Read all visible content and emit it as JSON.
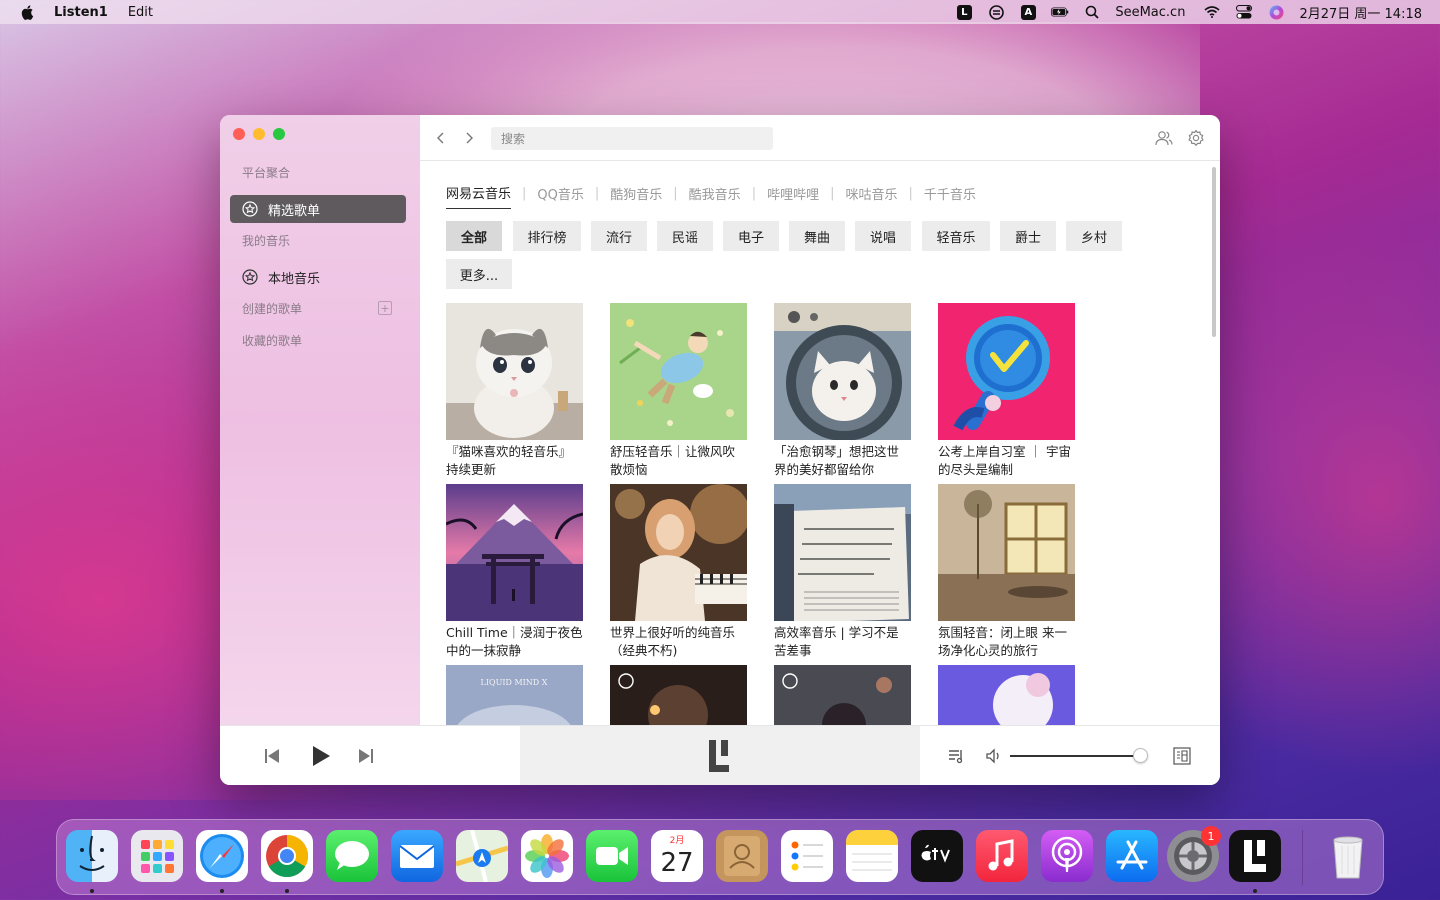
{
  "menubar": {
    "app_name": "Listen1",
    "menus": [
      "Edit"
    ],
    "status_text": "SeeMac.cn",
    "datetime": "2月27日 周一  14:18",
    "box_a_label": "A"
  },
  "sidebar": {
    "section_platform": "平台聚合",
    "item_featured": "精选歌单",
    "section_my_music": "我的音乐",
    "item_local": "本地音乐",
    "section_created": "创建的歌单",
    "section_favorited": "收藏的歌单"
  },
  "toolbar": {
    "search_placeholder": "搜索"
  },
  "platform_tabs": [
    "网易云音乐",
    "QQ音乐",
    "酷狗音乐",
    "酷我音乐",
    "哔哩哔哩",
    "咪咕音乐",
    "千千音乐"
  ],
  "genres": [
    "全部",
    "排行榜",
    "流行",
    "民谣",
    "电子",
    "舞曲",
    "说唱",
    "轻音乐",
    "爵士",
    "乡村",
    "更多..."
  ],
  "playlists": [
    {
      "title": "『猫咪喜欢的轻音乐』持续更新"
    },
    {
      "title": "舒压轻音乐｜让微风吹散烦恼"
    },
    {
      "title": "「治愈钢琴」想把这世界的美好都留给你"
    },
    {
      "title": "公考上岸自习室 ｜ 宇宙的尽头是编制"
    },
    {
      "title": "Chill Time｜浸润于夜色中的一抹寂静"
    },
    {
      "title": "世界上很好听的纯音乐（经典不朽)"
    },
    {
      "title": "高效率音乐 | 学习不是苦差事"
    },
    {
      "title": "氛围轻音：闭上眼 来一场净化心灵的旅行"
    }
  ],
  "cover_texts": {
    "liquid_mind": "LIQUID MIND X",
    "calendar_month": "2月",
    "calendar_day": "27"
  },
  "player": {
    "volume_percent": 95
  },
  "dock": {
    "settings_badge": "1",
    "apps": [
      "Finder",
      "Launchpad",
      "Safari",
      "Chrome",
      "Messages",
      "Mail",
      "Maps",
      "Photos",
      "FaceTime",
      "Calendar",
      "Contacts",
      "Reminders",
      "Notes",
      "TV",
      "Music",
      "Podcasts",
      "App Store",
      "System Preferences",
      "Listen1",
      "Trash"
    ]
  }
}
